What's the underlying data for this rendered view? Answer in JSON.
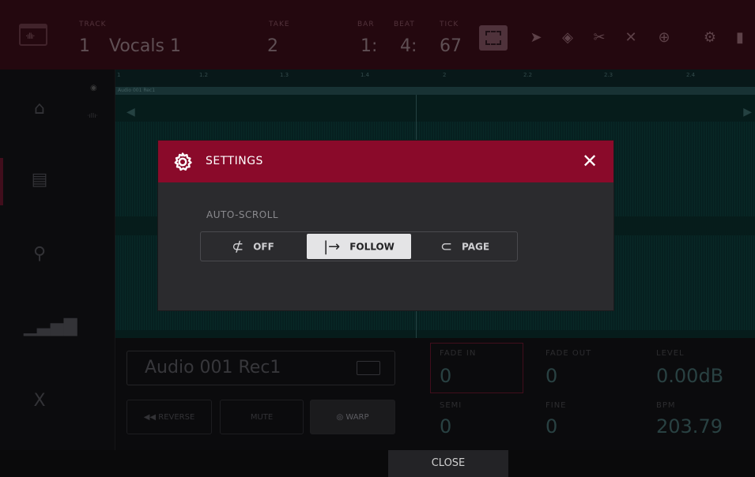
{
  "topbar": {
    "track_label": "TRACK",
    "track_number": "1",
    "track_name": "Vocals 1",
    "take_label": "TAKE",
    "take_value": "2",
    "bar_label": "BAR",
    "bar_value": "1:",
    "beat_label": "BEAT",
    "beat_value": "4:",
    "tick_label": "TICK",
    "tick_value": "67"
  },
  "ruler": {
    "ticks": [
      "1",
      "1.2",
      "1.3",
      "1.4",
      "2",
      "2.2",
      "2.3",
      "2.4"
    ]
  },
  "clip": {
    "name": "Audio 001 Rec1"
  },
  "bottom": {
    "clip_name": "Audio 001 Rec1",
    "reverse_label": "REVERSE",
    "mute_label": "MUTE",
    "warp_label": "WARP",
    "fade_in_label": "FADE IN",
    "fade_in_value": "0",
    "fade_out_label": "FADE OUT",
    "fade_out_value": "0",
    "level_label": "LEVEL",
    "level_value": "0.00dB",
    "semi_label": "SEMI",
    "semi_value": "0",
    "fine_label": "FINE",
    "fine_value": "0",
    "bpm_label": "BPM",
    "bpm_value": "203.79"
  },
  "modal": {
    "title": "SETTINGS",
    "auto_scroll_label": "AUTO-SCROLL",
    "options": [
      {
        "label": "OFF",
        "icon": "no-scroll-icon"
      },
      {
        "label": "FOLLOW",
        "icon": "follow-arrow-icon"
      },
      {
        "label": "PAGE",
        "icon": "page-return-icon"
      }
    ],
    "selected": "FOLLOW"
  },
  "footer": {
    "close_label": "CLOSE"
  },
  "colors": {
    "modal_header": "#8a0a2a",
    "modal_body": "#2b2b2e",
    "topbar": "#2a0a12",
    "waveform_bg": "#07201f",
    "selected_option": "#e4e4e6"
  }
}
